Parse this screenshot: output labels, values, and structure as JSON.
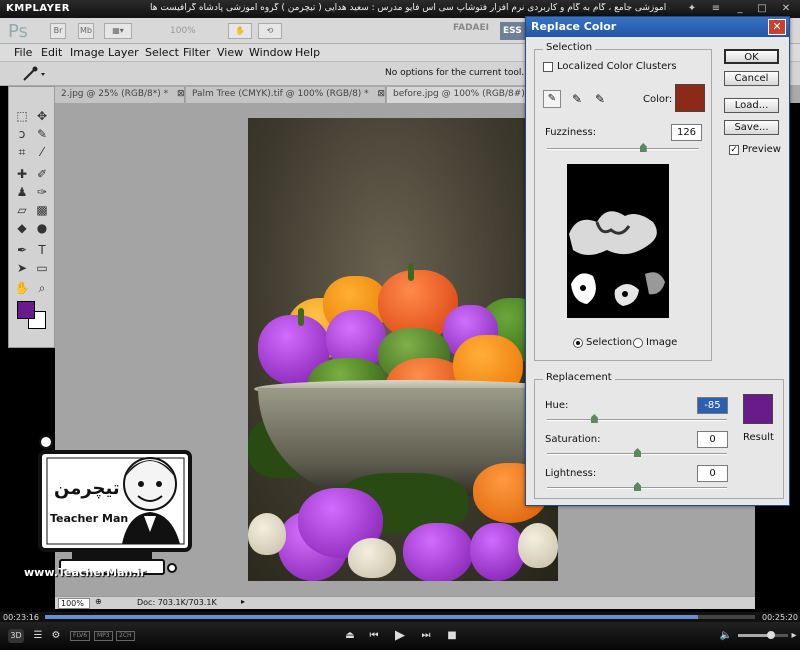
{
  "km": {
    "logo": "KMPLAYER",
    "caption": "مجموعه آموزشی جامع ، گام به گام و کاربردی نرم افزار فتوشاپ سی اس فایو مدرس : سعید هدایی ( تیچرمن ) گروه آموزشی پادشاه گرافیست ها",
    "time_elapsed": "00:23:16",
    "time_total": "00:25:20",
    "progress": 0.92,
    "tags": [
      "FLV6",
      "MP3",
      "2CH"
    ]
  },
  "ps": {
    "logo": "Ps",
    "zoom": "100%",
    "workspace": "FADAEI",
    "workspace_active": "ESS",
    "menus": [
      "File",
      "Edit",
      "Image",
      "Layer",
      "Select",
      "Filter",
      "View",
      "Window",
      "Help"
    ],
    "options_msg": "No options for the current tool.",
    "tabs": [
      {
        "label": "2.jpg @ 25% (RGB/8*) *"
      },
      {
        "label": "Palm Tree (CMYK).tif @ 100% (RGB/8) *"
      },
      {
        "label": "before.jpg @ 100% (RGB/8#)"
      }
    ],
    "status_zoom": "100%",
    "status_doc": "Doc: 703.1K/703.1K"
  },
  "watermark": {
    "site": "www.TeacherMan.ir",
    "brand": "Teacher Man",
    "brand_fa": "تیچرمن"
  },
  "dialog": {
    "title": "Replace Color",
    "selection_group": "Selection",
    "localized_label": "Localized Color Clusters",
    "color_label": "Color:",
    "color_value": "#8a2a17",
    "fuzziness_label": "Fuzziness:",
    "fuzziness_value": "126",
    "fuzziness_level": 0.63,
    "radio_selection": "Selection",
    "radio_image": "Image",
    "replacement_group": "Replacement",
    "hue_label": "Hue:",
    "hue_value": "-85",
    "hue_level": 0.26,
    "sat_label": "Saturation:",
    "sat_value": "0",
    "sat_level": 0.5,
    "light_label": "Lightness:",
    "light_value": "0",
    "light_level": 0.5,
    "result_label": "Result",
    "result_color": "#6a1b8a",
    "ok": "OK",
    "cancel": "Cancel",
    "load": "Load...",
    "save": "Save...",
    "preview": "Preview"
  }
}
